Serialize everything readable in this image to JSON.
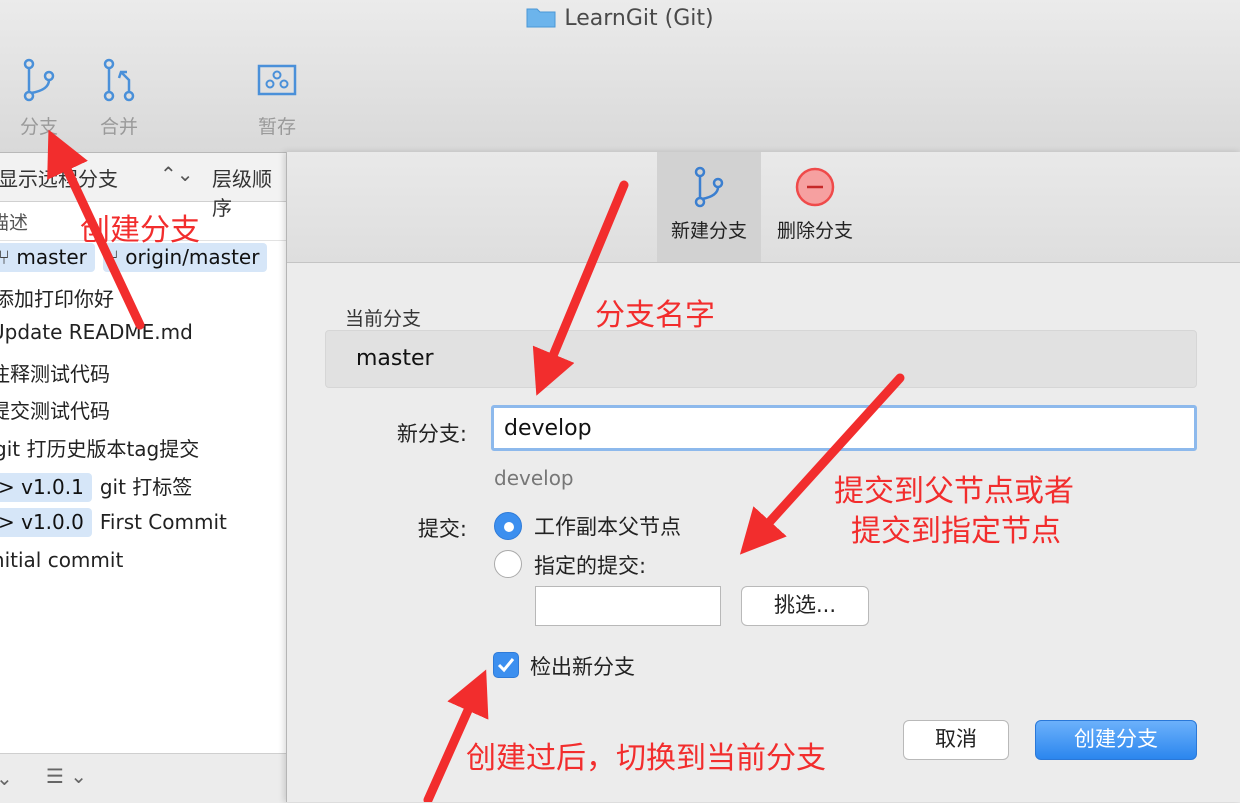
{
  "window": {
    "title": "LearnGit (Git)"
  },
  "toolbar": {
    "branch_label": "分支",
    "merge_label": "合并",
    "stash_label": "暂存"
  },
  "history": {
    "filter_left": "显示远程分支",
    "filter_right": "层级顺序",
    "desc_header": "描述",
    "branch_badges": [
      "master",
      "origin/master"
    ],
    "rows": [
      {
        "tag": "",
        "message": "添加打印你好"
      },
      {
        "tag": "",
        "message": "Update README.md"
      },
      {
        "tag": "",
        "message": "注释测试代码"
      },
      {
        "tag": "",
        "message": "提交测试代码"
      },
      {
        "tag": "",
        "message": "git 打历史版本tag提交"
      },
      {
        "tag": "v1.0.1",
        "message": "git 打标签"
      },
      {
        "tag": "v1.0.0",
        "message": "First Commit"
      },
      {
        "tag": "",
        "message": "Initial commit"
      }
    ]
  },
  "dialog": {
    "tabs": [
      {
        "label": "新建分支",
        "active": true
      },
      {
        "label": "删除分支",
        "active": false
      }
    ],
    "current_branch_label": "当前分支",
    "current_branch_value": "master",
    "new_branch_label": "新分支:",
    "new_branch_value": "develop",
    "new_branch_preview": "develop",
    "commit_label": "提交:",
    "commit_options": [
      {
        "label": "工作副本父节点",
        "selected": true
      },
      {
        "label": "指定的提交:",
        "selected": false
      }
    ],
    "pick_button": "挑选...",
    "checkout_label": "检出新分支",
    "checkout_checked": true,
    "cancel_button": "取消",
    "create_button": "创建分支"
  },
  "annotations": {
    "create_branch": "创建分支",
    "branch_name": "分支名字",
    "commit_hint_line1": "提交到父节点或者",
    "commit_hint_line2": "提交到指定节点",
    "after_create": "创建过后，切换到当前分支"
  },
  "colors": {
    "accent": "#3c8fef",
    "annotation_red": "#f22d2d",
    "delete_icon": "#ef4a4a"
  }
}
